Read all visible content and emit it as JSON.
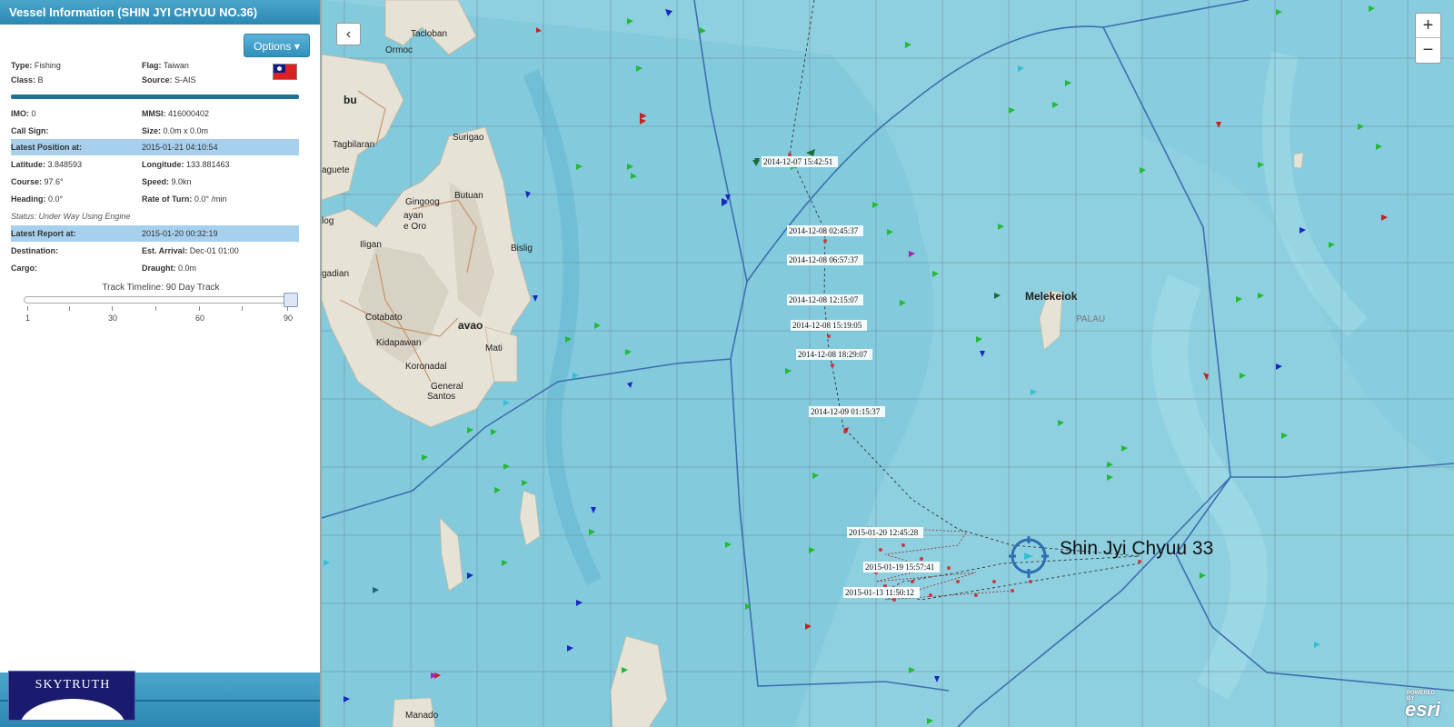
{
  "sidebar": {
    "title": "Vessel Information (SHIN JYI CHYUU NO.36)",
    "options_label": "Options",
    "options_caret": "▾",
    "fields": {
      "type_label": "Type:",
      "type_value": "Fishing",
      "flag_label": "Flag:",
      "flag_value": "Taiwan",
      "class_label": "Class:",
      "class_value": "B",
      "source_label": "Source:",
      "source_value": "S-AIS",
      "imo_label": "IMO:",
      "imo_value": "0",
      "mmsi_label": "MMSI:",
      "mmsi_value": "416000402",
      "callsign_label": "Call Sign:",
      "callsign_value": "",
      "size_label": "Size:",
      "size_value": "0.0m x 0.0m",
      "latest_pos_label": "Latest Position at:",
      "latest_pos_value": "2015-01-21 04:10:54",
      "lat_label": "Latitude:",
      "lat_value": "3.848593",
      "lon_label": "Longitude:",
      "lon_value": "133.881463",
      "course_label": "Course:",
      "course_value": "97.6°",
      "speed_label": "Speed:",
      "speed_value": "9.0kn",
      "heading_label": "Heading:",
      "heading_value": "0.0°",
      "rot_label": "Rate of Turn:",
      "rot_value": "0.0° /min",
      "status": "Status: Under Way Using Engine",
      "latest_report_label": "Latest Report at:",
      "latest_report_value": "2015-01-20 00:32:19",
      "dest_label": "Destination:",
      "dest_value": "",
      "eta_label": "Est. Arrival:",
      "eta_value": "Dec-01 01:00",
      "cargo_label": "Cargo:",
      "cargo_value": "",
      "draught_label": "Draught:",
      "draught_value": "0.0m"
    },
    "timeline": {
      "label": "Track Timeline: 90 Day Track",
      "ticks": [
        "1",
        "30",
        "60",
        "90"
      ],
      "value_days": 90
    },
    "logo_text": "SKYTRUTH"
  },
  "map": {
    "collapse_icon": "‹",
    "zoom_in": "+",
    "zoom_out": "−",
    "places": [
      "Tacloban",
      "Ormoc",
      "bu",
      "Tagbilaran",
      "aguete",
      "Surigao",
      "Butuan",
      "Gingoog",
      "ayan",
      "e Oro",
      "log",
      "Iligan",
      "Bislig",
      "gadian",
      "Cotabato",
      "avao",
      "Mati",
      "Kidapawan",
      "Koronadal",
      "General",
      "Santos",
      "Melekeiok",
      "PALAU",
      "Manado"
    ],
    "track_labels": [
      "2014-12-07 15:42:51",
      "2014-12-08 02:45:37",
      "2014-12-08 06:57:37",
      "2014-12-08 12:15:07",
      "2014-12-08 15:19:05",
      "2014-12-08 18:29:07",
      "2014-12-09 01:15:37",
      "2015-01-20 12:45:28",
      "2015-01-19 15:57:41",
      "2015-01-13 11:50:12"
    ],
    "vessel_label": "Shin Jyi Chyuu 33",
    "esri": "esri",
    "esri_small": "POWERED BY"
  },
  "colors": {
    "header": "#2a88b2",
    "highlight": "#a7d0ef",
    "sea": "#8fd0e0",
    "land": "#e6e2d6"
  }
}
